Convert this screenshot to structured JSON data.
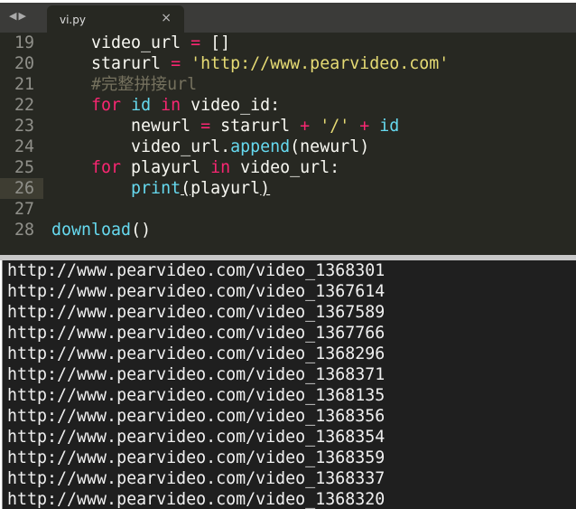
{
  "tab": {
    "filename": "vi.py",
    "close": "×",
    "nav": "◀▶"
  },
  "code_lines": [
    {
      "n": "19",
      "parts": [
        [
          "",
          "    video_url "
        ],
        [
          "op",
          "="
        ],
        [
          "",
          " []"
        ]
      ]
    },
    {
      "n": "20",
      "parts": [
        [
          "",
          "    starurl "
        ],
        [
          "op",
          "="
        ],
        [
          "",
          " "
        ],
        [
          "st",
          "'http://www.pearvideo.com'"
        ]
      ]
    },
    {
      "n": "21",
      "parts": [
        [
          "cm",
          "    #完整拼接url"
        ]
      ]
    },
    {
      "n": "22",
      "parts": [
        [
          "kw",
          "    for"
        ],
        [
          "",
          " "
        ],
        [
          "bi",
          "id"
        ],
        [
          "",
          " "
        ],
        [
          "kw",
          "in"
        ],
        [
          "",
          " video_id:"
        ]
      ]
    },
    {
      "n": "23",
      "parts": [
        [
          "",
          "        newurl "
        ],
        [
          "op",
          "="
        ],
        [
          "",
          " starurl "
        ],
        [
          "op",
          "+"
        ],
        [
          "",
          " "
        ],
        [
          "st",
          "'/'"
        ],
        [
          "",
          " "
        ],
        [
          "op",
          "+"
        ],
        [
          "",
          " "
        ],
        [
          "bi",
          "id"
        ]
      ]
    },
    {
      "n": "24",
      "parts": [
        [
          "",
          "        video_url."
        ],
        [
          "bi",
          "append"
        ],
        [
          "",
          "(newurl)"
        ]
      ]
    },
    {
      "n": "25",
      "parts": [
        [
          "kw",
          "    for"
        ],
        [
          "",
          " playurl "
        ],
        [
          "kw",
          "in"
        ],
        [
          "",
          " video_url:"
        ]
      ]
    },
    {
      "n": "26",
      "parts": [
        [
          "bi",
          "        print"
        ],
        [
          "u",
          "("
        ],
        [
          "",
          "playurl"
        ],
        [
          "u",
          ")"
        ]
      ]
    },
    {
      "n": "27",
      "parts": []
    },
    {
      "n": "28",
      "parts": [
        [
          "bi",
          "download"
        ],
        [
          "",
          "()"
        ]
      ]
    }
  ],
  "output": [
    "http://www.pearvideo.com/video_1368301",
    "http://www.pearvideo.com/video_1367614",
    "http://www.pearvideo.com/video_1367589",
    "http://www.pearvideo.com/video_1367766",
    "http://www.pearvideo.com/video_1368296",
    "http://www.pearvideo.com/video_1368371",
    "http://www.pearvideo.com/video_1368135",
    "http://www.pearvideo.com/video_1368356",
    "http://www.pearvideo.com/video_1368354",
    "http://www.pearvideo.com/video_1368359",
    "http://www.pearvideo.com/video_1368337",
    "http://www.pearvideo.com/video_1368320"
  ]
}
